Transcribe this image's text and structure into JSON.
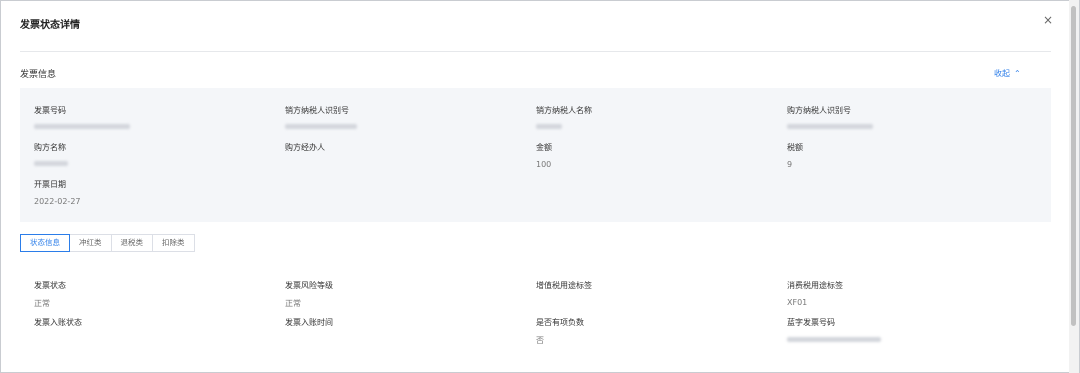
{
  "dialog": {
    "title": "发票状态详情",
    "close_glyph": "×"
  },
  "invoice_info": {
    "section_title": "发票信息",
    "collapse_label": "收起",
    "collapse_glyph": "⌃",
    "fields": {
      "invoice_number": {
        "label": "发票号码",
        "value": ""
      },
      "seller_tax_id": {
        "label": "销方纳税人识别号",
        "value": ""
      },
      "seller_name": {
        "label": "销方纳税人名称",
        "value": ""
      },
      "buyer_tax_id": {
        "label": "购方纳税人识别号",
        "value": ""
      },
      "buyer_name": {
        "label": "购方名称",
        "value": ""
      },
      "buyer_agent": {
        "label": "购方经办人",
        "value": ""
      },
      "amount": {
        "label": "金额",
        "value": "100"
      },
      "tax_amount": {
        "label": "税额",
        "value": "9"
      },
      "issue_date": {
        "label": "开票日期",
        "value": "2022-02-27"
      }
    }
  },
  "tabs": [
    {
      "label": "状态信息",
      "active": true
    },
    {
      "label": "冲红类",
      "active": false
    },
    {
      "label": "退税类",
      "active": false
    },
    {
      "label": "扣除类",
      "active": false
    }
  ],
  "status_info": {
    "fields": {
      "invoice_status": {
        "label": "发票状态",
        "value": "正常"
      },
      "risk_level": {
        "label": "发票风险等级",
        "value": "正常"
      },
      "vat_purpose_flag": {
        "label": "增值税用途标签",
        "value": ""
      },
      "consumption_tax_flag": {
        "label": "消费税用途标签",
        "value": "XF01"
      },
      "accounting_status": {
        "label": "发票入账状态",
        "value": ""
      },
      "accounting_time": {
        "label": "发票入账时间",
        "value": ""
      },
      "has_negative_items": {
        "label": "是否有项负数",
        "value": "否"
      },
      "digital_invoice_number": {
        "label": "蓝字发票号码",
        "value": ""
      }
    }
  },
  "colors": {
    "accent": "#2b7de9",
    "panel_bg": "#f4f6f9",
    "border": "#dcdfe6"
  }
}
